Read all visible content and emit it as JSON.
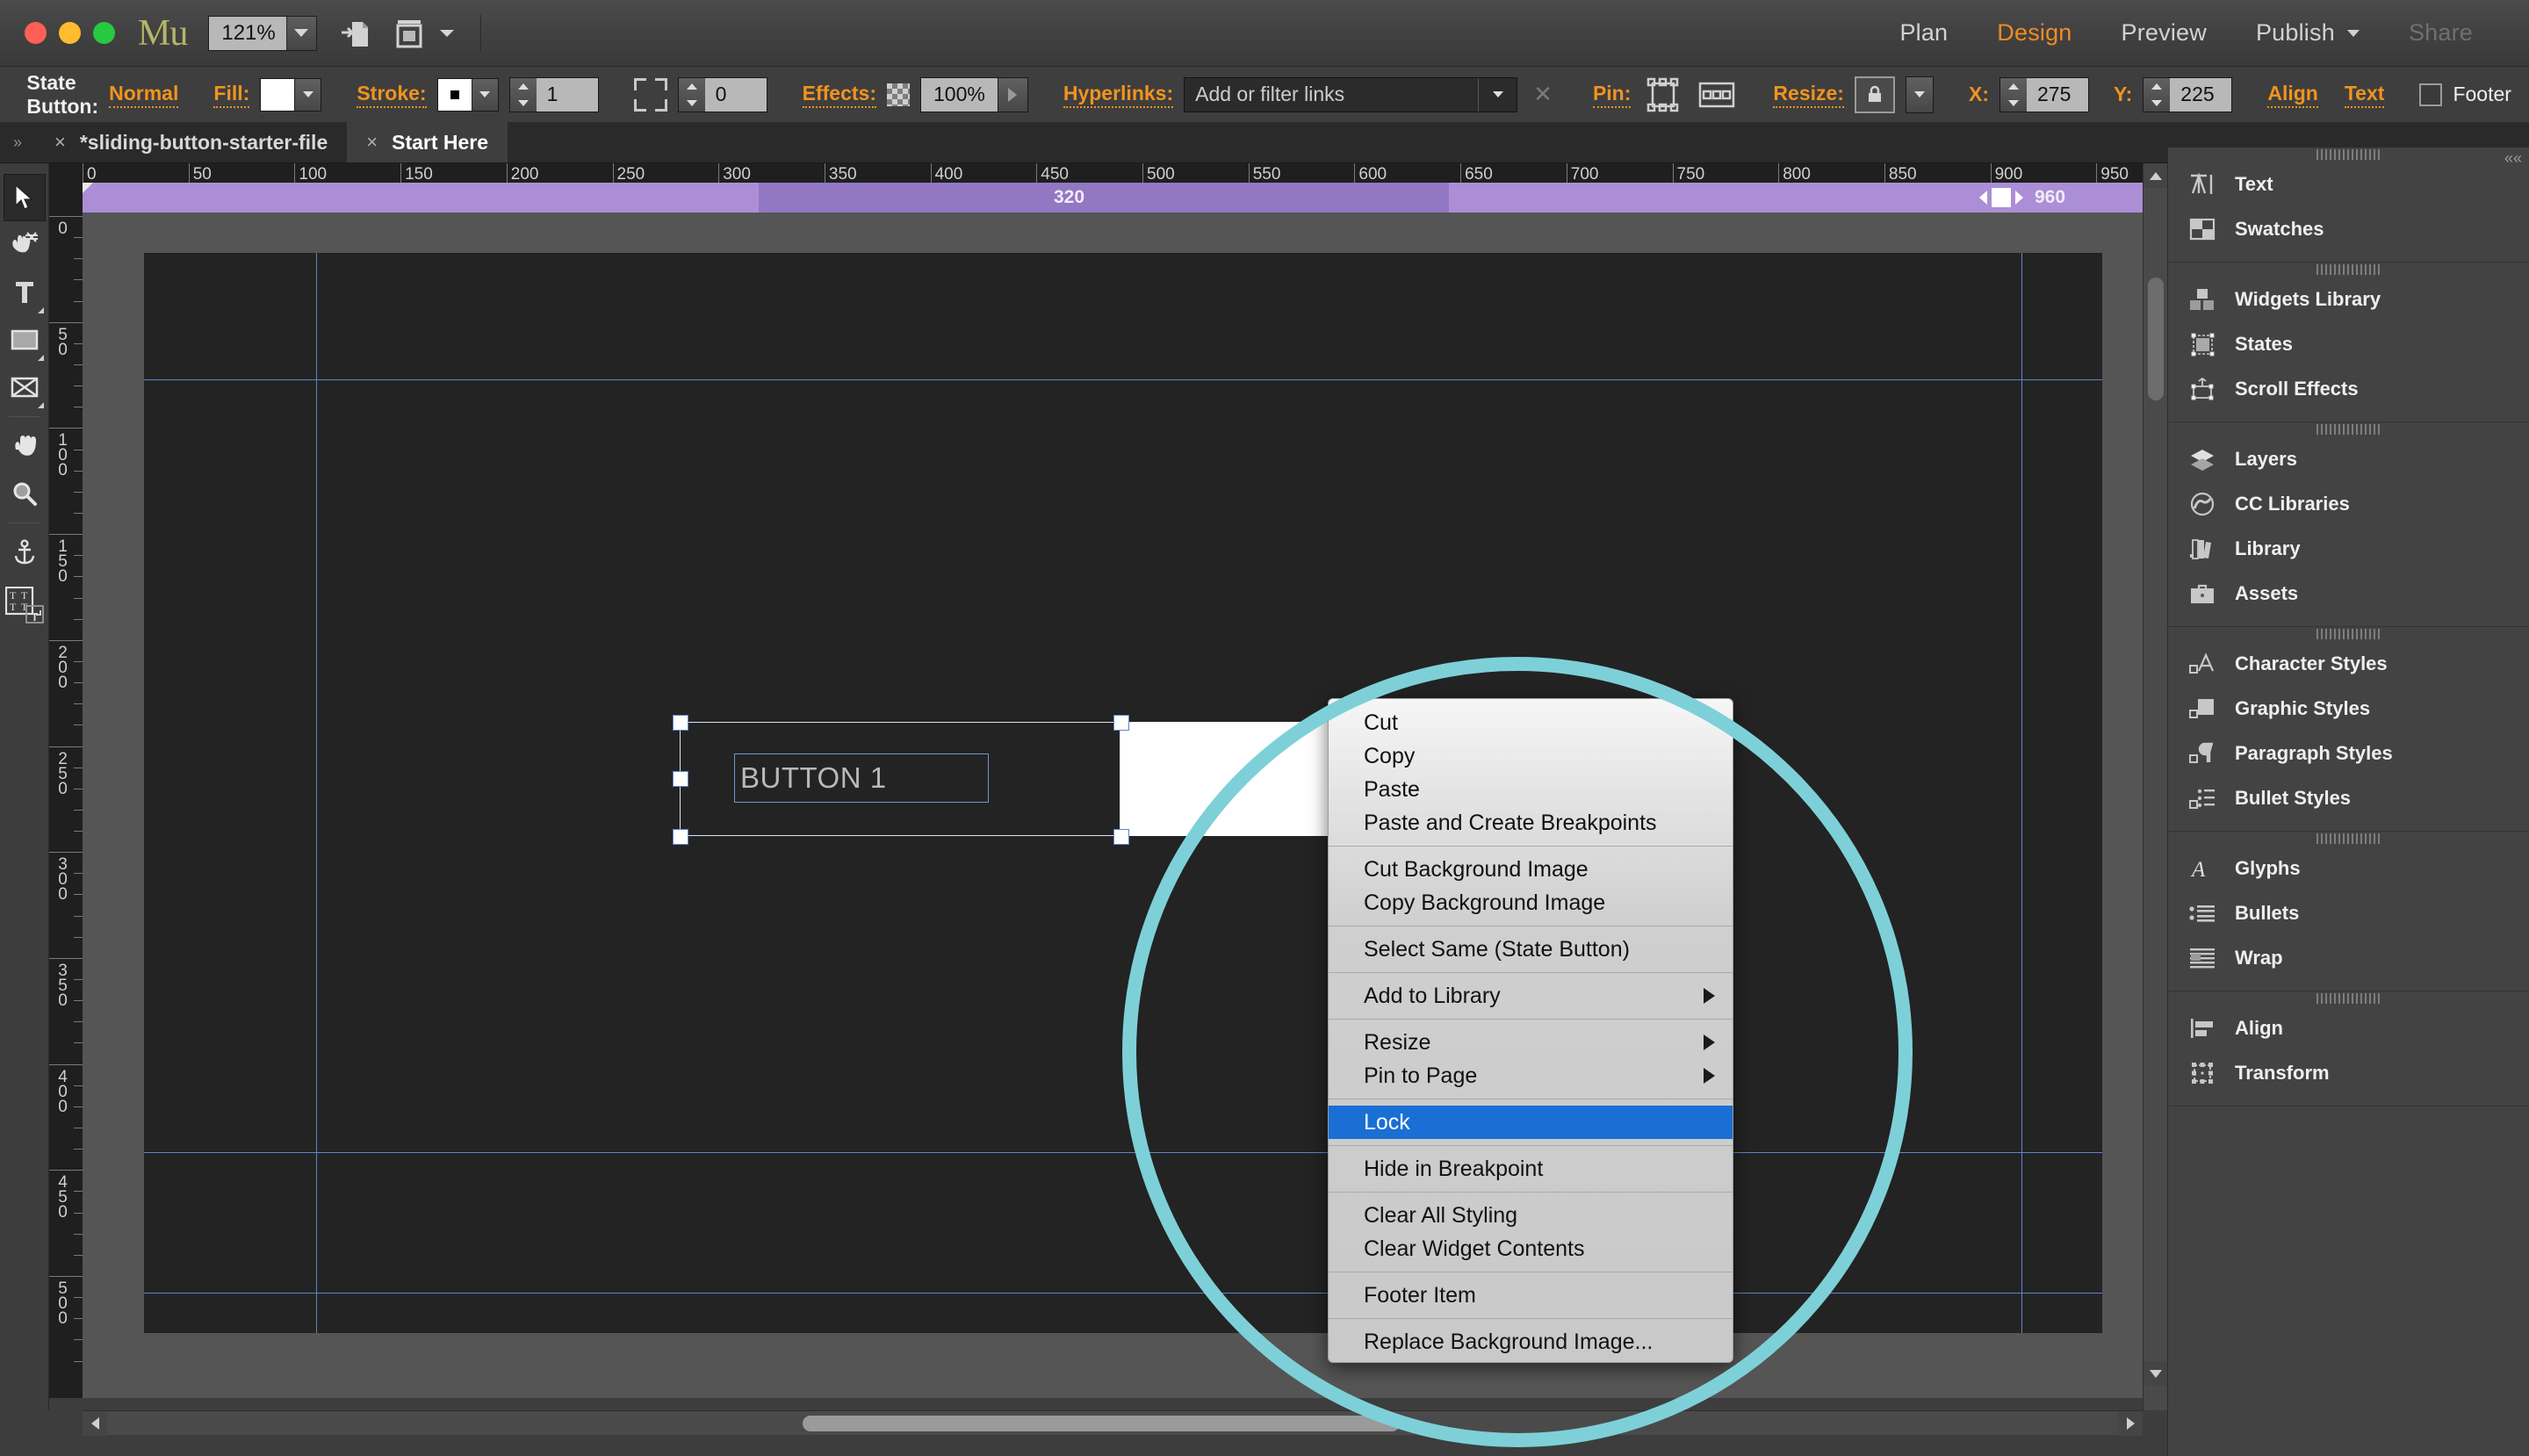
{
  "titlebar": {
    "app_logo": "Mu",
    "zoom_level": "121%",
    "icons": [
      "export-page-icon",
      "breakpoint-icon"
    ],
    "nav": [
      {
        "label": "Plan",
        "state": "normal"
      },
      {
        "label": "Design",
        "state": "active"
      },
      {
        "label": "Preview",
        "state": "normal"
      },
      {
        "label": "Publish",
        "state": "normal",
        "caret": true
      },
      {
        "label": "Share",
        "state": "disabled"
      }
    ]
  },
  "controlbar": {
    "state_label": "State Button:",
    "state_value": "Normal",
    "fill_label": "Fill:",
    "stroke_label": "Stroke:",
    "stroke_width": "1",
    "corner_radius": "0",
    "effects_label": "Effects:",
    "effects_value": "100%",
    "hyperlinks_label": "Hyperlinks:",
    "hyperlinks_value": "Add or filter links",
    "pin_label": "Pin:",
    "resize_label": "Resize:",
    "x_label": "X:",
    "x_value": "275",
    "y_label": "Y:",
    "y_value": "225",
    "align_label": "Align",
    "text_label": "Text",
    "footer_label": "Footer"
  },
  "tabs": [
    {
      "label": "*sliding-button-starter-file",
      "active": false,
      "close": "×"
    },
    {
      "label": "Start Here",
      "active": true,
      "close": "×"
    }
  ],
  "rulers": {
    "h_ticks": [
      "0",
      "50",
      "100",
      "150",
      "200",
      "250",
      "300",
      "350",
      "400",
      "450",
      "500",
      "550",
      "600",
      "650",
      "700",
      "750",
      "800",
      "850",
      "900",
      "950"
    ],
    "v_ticks": [
      "0",
      "50",
      "100",
      "150",
      "200",
      "250",
      "300",
      "350",
      "400",
      "450",
      "500"
    ]
  },
  "breakpoints": {
    "left_label": "320",
    "right_label": "960"
  },
  "canvas": {
    "button_text": "BUTTON 1"
  },
  "context_menu": {
    "groups": [
      [
        {
          "label": "Cut",
          "submenu": false,
          "highlighted": false
        },
        {
          "label": "Copy",
          "submenu": false,
          "highlighted": false
        },
        {
          "label": "Paste",
          "submenu": false,
          "highlighted": false
        },
        {
          "label": "Paste and Create Breakpoints",
          "submenu": false,
          "highlighted": false
        }
      ],
      [
        {
          "label": "Cut Background Image",
          "submenu": false,
          "highlighted": false
        },
        {
          "label": "Copy Background Image",
          "submenu": false,
          "highlighted": false
        }
      ],
      [
        {
          "label": "Select Same (State Button)",
          "submenu": false,
          "highlighted": false
        }
      ],
      [
        {
          "label": "Add to Library",
          "submenu": true,
          "highlighted": false
        }
      ],
      [
        {
          "label": "Resize",
          "submenu": true,
          "highlighted": false
        },
        {
          "label": "Pin to Page",
          "submenu": true,
          "highlighted": false
        }
      ],
      [
        {
          "label": "Lock",
          "submenu": false,
          "highlighted": true
        }
      ],
      [
        {
          "label": "Hide in Breakpoint",
          "submenu": false,
          "highlighted": false
        }
      ],
      [
        {
          "label": "Clear All Styling",
          "submenu": false,
          "highlighted": false
        },
        {
          "label": "Clear Widget Contents",
          "submenu": false,
          "highlighted": false
        }
      ],
      [
        {
          "label": "Footer Item",
          "submenu": false,
          "highlighted": false
        }
      ],
      [
        {
          "label": "Replace Background Image...",
          "submenu": false,
          "highlighted": false
        }
      ]
    ],
    "highlight_color": "#1a6fd4"
  },
  "left_toolbar": [
    {
      "name": "selection-tool",
      "glyph": "➤",
      "selected": true
    },
    {
      "name": "crop-tool",
      "glyph": "✂",
      "selected": false
    },
    {
      "name": "text-tool",
      "glyph": "T",
      "selected": false
    },
    {
      "name": "rectangle-tool",
      "glyph": "▣",
      "selected": false
    },
    {
      "name": "image-frame-tool",
      "glyph": "⌧",
      "selected": false
    },
    {
      "name": "hand-tool",
      "glyph": "✋",
      "selected": false
    },
    {
      "name": "zoom-tool",
      "glyph": "⚲",
      "selected": false
    },
    {
      "name": "anchor-tool",
      "glyph": "⚓",
      "selected": false
    },
    {
      "name": "type-grid-tool",
      "glyph": "TT",
      "selected": false
    }
  ],
  "right_panel": {
    "groups": [
      {
        "items": [
          {
            "label": "Text",
            "icon": "text-panel-icon"
          },
          {
            "label": "Swatches",
            "icon": "swatches-panel-icon"
          }
        ]
      },
      {
        "items": [
          {
            "label": "Widgets Library",
            "icon": "widgets-library-panel-icon"
          },
          {
            "label": "States",
            "icon": "states-panel-icon"
          },
          {
            "label": "Scroll Effects",
            "icon": "scroll-effects-panel-icon"
          }
        ]
      },
      {
        "items": [
          {
            "label": "Layers",
            "icon": "layers-panel-icon"
          },
          {
            "label": "CC Libraries",
            "icon": "cc-libraries-panel-icon"
          },
          {
            "label": "Library",
            "icon": "library-panel-icon"
          },
          {
            "label": "Assets",
            "icon": "assets-panel-icon"
          }
        ]
      },
      {
        "items": [
          {
            "label": "Character Styles",
            "icon": "character-styles-panel-icon"
          },
          {
            "label": "Graphic Styles",
            "icon": "graphic-styles-panel-icon"
          },
          {
            "label": "Paragraph Styles",
            "icon": "paragraph-styles-panel-icon"
          },
          {
            "label": "Bullet Styles",
            "icon": "bullet-styles-panel-icon"
          }
        ]
      },
      {
        "items": [
          {
            "label": "Glyphs",
            "icon": "glyphs-panel-icon"
          },
          {
            "label": "Bullets",
            "icon": "bullets-panel-icon"
          },
          {
            "label": "Wrap",
            "icon": "wrap-panel-icon"
          }
        ]
      },
      {
        "items": [
          {
            "label": "Align",
            "icon": "align-panel-icon"
          },
          {
            "label": "Transform",
            "icon": "transform-panel-icon"
          }
        ]
      }
    ]
  },
  "colors": {
    "accent_orange": "#f0941f",
    "breakpoint_purple": "#ab8ed6",
    "highlight_blue": "#1a6fd4",
    "annotation_teal": "#7ed0d8"
  }
}
